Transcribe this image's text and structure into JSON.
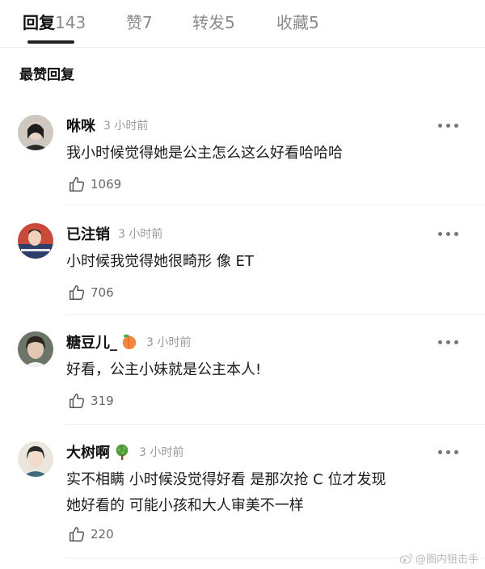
{
  "tabs": [
    {
      "label": "回复",
      "count": "143",
      "active": true
    },
    {
      "label": "赞",
      "count": "7"
    },
    {
      "label": "转发",
      "count": "5"
    },
    {
      "label": "收藏",
      "count": "5"
    }
  ],
  "section_title": "最赞回复",
  "comments": [
    {
      "username": "咻咪",
      "badge": "",
      "time": "3 小时前",
      "lines": [
        "我小时候觉得她是公主怎么这么好看哈哈哈"
      ],
      "likes": "1069"
    },
    {
      "username": "已注销",
      "badge": "",
      "time": "3 小时前",
      "lines": [
        "小时候我觉得她很畸形 像 ET"
      ],
      "likes": "706"
    },
    {
      "username": "糖豆儿_",
      "badge": "peach-icon",
      "time": "3 小时前",
      "lines": [
        "好看，公主小妹就是公主本人!"
      ],
      "likes": "319"
    },
    {
      "username": "大树啊",
      "badge": "tree-icon",
      "time": "3 小时前",
      "lines": [
        "实不相瞒 小时候没觉得好看 是那次抢 C 位才发现",
        "她好看的 可能小孩和大人审美不一样"
      ],
      "likes": "220"
    }
  ],
  "watermark": {
    "text": "@圈内狙击手",
    "icon": "weibo-icon"
  },
  "colors": {
    "text": "#1a1a1a",
    "muted": "#8a8a8a",
    "divider": "#eeeeee"
  }
}
